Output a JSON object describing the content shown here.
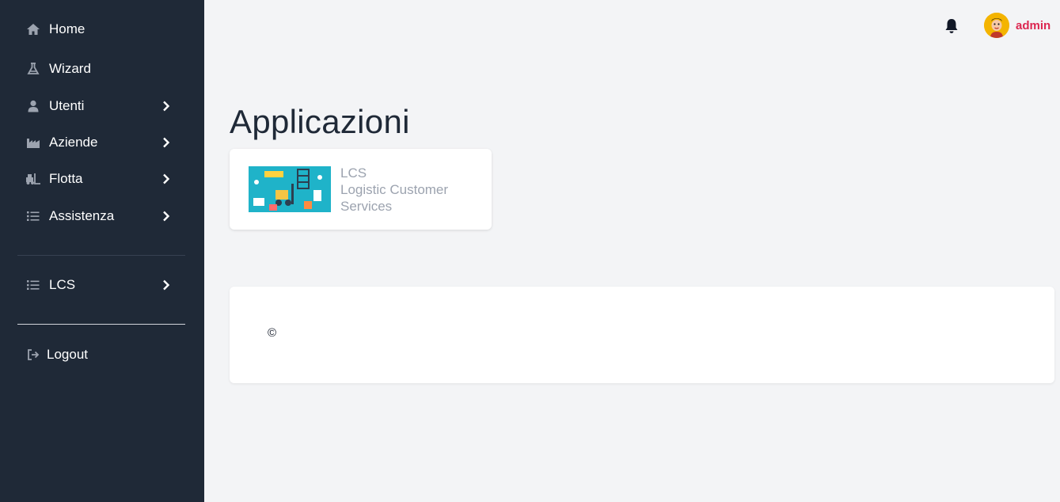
{
  "sidebar": {
    "items": [
      {
        "label": "Home",
        "icon": "home-icon",
        "has_submenu": false
      },
      {
        "label": "Wizard",
        "icon": "flask-icon",
        "has_submenu": false
      },
      {
        "label": "Utenti",
        "icon": "user-icon",
        "has_submenu": true
      },
      {
        "label": "Aziende",
        "icon": "factory-icon",
        "has_submenu": true
      },
      {
        "label": "Flotta",
        "icon": "forklift-icon",
        "has_submenu": true
      },
      {
        "label": "Assistenza",
        "icon": "list-icon",
        "has_submenu": true
      }
    ],
    "section2": [
      {
        "label": "LCS",
        "icon": "list-icon",
        "has_submenu": true
      }
    ],
    "logout": {
      "label": "Logout",
      "icon": "logout-icon"
    }
  },
  "topbar": {
    "notifications_icon": "bell-icon",
    "user": {
      "name": "admin",
      "avatar": "avatar-icon"
    }
  },
  "main": {
    "title": "Applicazioni",
    "apps": [
      {
        "code": "LCS",
        "name": "Logistic Customer Services"
      }
    ]
  },
  "footer": {
    "copyright": "©"
  },
  "colors": {
    "sidebar_bg": "#1f2937",
    "page_bg": "#f3f4f6",
    "username": "#dc2650",
    "muted_text": "#9ca3af"
  }
}
